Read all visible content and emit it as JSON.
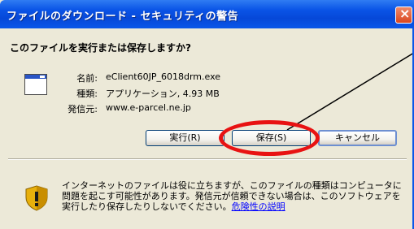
{
  "window": {
    "title": "ファイルのダウンロード - セキュリティの警告",
    "close_symbol": "×"
  },
  "question": "このファイルを実行または保存しますか?",
  "file": {
    "icon": "window-file-icon",
    "name_label": "名前:",
    "name_value": "eClient60JP_6018drm.exe",
    "type_label": "種類:",
    "type_value": "アプリケーション, 4.93 MB",
    "from_label": "発信元:",
    "from_value": "www.e-parcel.ne.jp"
  },
  "buttons": {
    "run": "実行(R)",
    "save": "保存(S)",
    "cancel": "キャンセル"
  },
  "warning": {
    "icon": "shield-warning-icon",
    "text": "インターネットのファイルは役に立ちますが、このファイルの種類はコンピュータに問題を起こす可能性があります。発信元が信頼できない場合は、このソフトウェアを実行したり保存したりしないでください。",
    "link": "危険性の説明"
  },
  "colors": {
    "titlebar": "#0a54e6",
    "highlight": "#e81212"
  }
}
